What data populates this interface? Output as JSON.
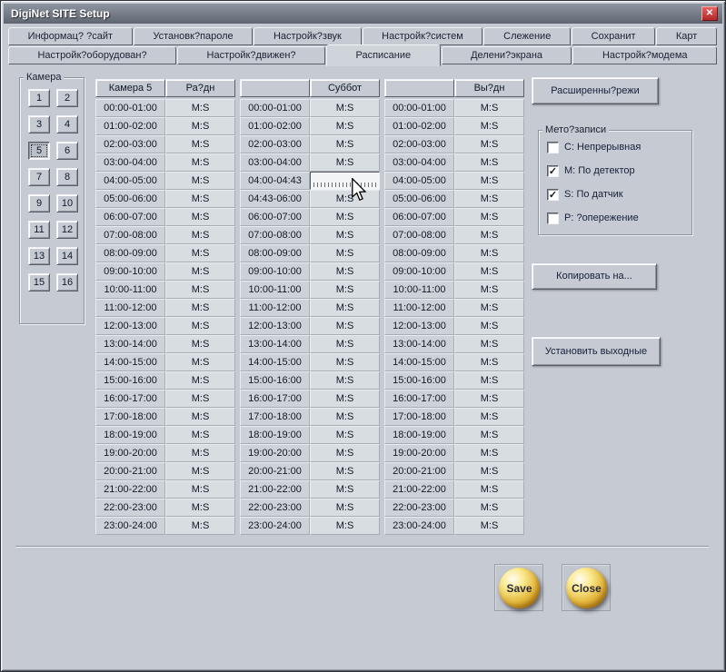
{
  "window": {
    "title": "DigiNet SITE Setup",
    "close_glyph": "✕"
  },
  "tabs": {
    "row1": [
      {
        "label": "Информац? ?сайт",
        "active": false
      },
      {
        "label": "Установк?пароле",
        "active": false
      },
      {
        "label": "Настройк?звук",
        "active": false
      },
      {
        "label": "Настройк?систем",
        "active": false
      },
      {
        "label": "Слежение",
        "active": false
      },
      {
        "label": "Сохранит",
        "active": false
      },
      {
        "label": "Карт",
        "active": false
      }
    ],
    "row2": [
      {
        "label": "Настройк?оборудован?",
        "active": false
      },
      {
        "label": "Настройк?движен?",
        "active": false
      },
      {
        "label": "Расписание",
        "active": true
      },
      {
        "label": "Делени?экрана",
        "active": false
      },
      {
        "label": "Настройк?модема",
        "active": false
      }
    ]
  },
  "camera": {
    "group_label": "Камера",
    "buttons": [
      "1",
      "2",
      "3",
      "4",
      "5",
      "6",
      "7",
      "8",
      "9",
      "10",
      "11",
      "12",
      "13",
      "14",
      "15",
      "16"
    ],
    "selected": "5"
  },
  "schedule": {
    "groups": [
      {
        "time_header": "Камера 5",
        "value_header": "Ра?дн",
        "times": [
          "00:00-01:00",
          "01:00-02:00",
          "02:00-03:00",
          "03:00-04:00",
          "04:00-05:00",
          "05:00-06:00",
          "06:00-07:00",
          "07:00-08:00",
          "08:00-09:00",
          "09:00-10:00",
          "10:00-11:00",
          "11:00-12:00",
          "12:00-13:00",
          "13:00-14:00",
          "14:00-15:00",
          "15:00-16:00",
          "16:00-17:00",
          "17:00-18:00",
          "18:00-19:00",
          "19:00-20:00",
          "20:00-21:00",
          "21:00-22:00",
          "22:00-23:00",
          "23:00-24:00"
        ],
        "values": [
          "M:S",
          "M:S",
          "M:S",
          "M:S",
          "M:S",
          "M:S",
          "M:S",
          "M:S",
          "M:S",
          "M:S",
          "M:S",
          "M:S",
          "M:S",
          "M:S",
          "M:S",
          "M:S",
          "M:S",
          "M:S",
          "M:S",
          "M:S",
          "M:S",
          "M:S",
          "M:S",
          "M:S"
        ]
      },
      {
        "time_header": "",
        "value_header": "Суббот",
        "times": [
          "00:00-01:00",
          "01:00-02:00",
          "02:00-03:00",
          "03:00-04:00",
          "04:00-04:43",
          "04:43-06:00",
          "06:00-07:00",
          "07:00-08:00",
          "08:00-09:00",
          "09:00-10:00",
          "10:00-11:00",
          "11:00-12:00",
          "12:00-13:00",
          "13:00-14:00",
          "14:00-15:00",
          "15:00-16:00",
          "16:00-17:00",
          "17:00-18:00",
          "18:00-19:00",
          "19:00-20:00",
          "20:00-21:00",
          "21:00-22:00",
          "22:00-23:00",
          "23:00-24:00"
        ],
        "values": [
          "M:S",
          "M:S",
          "M:S",
          "M:S",
          "",
          "M:S",
          "M:S",
          "M:S",
          "M:S",
          "M:S",
          "M:S",
          "M:S",
          "M:S",
          "M:S",
          "M:S",
          "M:S",
          "M:S",
          "M:S",
          "M:S",
          "M:S",
          "M:S",
          "M:S",
          "M:S",
          "M:S"
        ],
        "edited_row": 4
      },
      {
        "time_header": "",
        "value_header": "Вы?дн",
        "times": [
          "00:00-01:00",
          "01:00-02:00",
          "02:00-03:00",
          "03:00-04:00",
          "04:00-05:00",
          "05:00-06:00",
          "06:00-07:00",
          "07:00-08:00",
          "08:00-09:00",
          "09:00-10:00",
          "10:00-11:00",
          "11:00-12:00",
          "12:00-13:00",
          "13:00-14:00",
          "14:00-15:00",
          "15:00-16:00",
          "16:00-17:00",
          "17:00-18:00",
          "18:00-19:00",
          "19:00-20:00",
          "20:00-21:00",
          "21:00-22:00",
          "22:00-23:00",
          "23:00-24:00"
        ],
        "values": [
          "M:S",
          "M:S",
          "M:S",
          "M:S",
          "M:S",
          "M:S",
          "M:S",
          "M:S",
          "M:S",
          "M:S",
          "M:S",
          "M:S",
          "M:S",
          "M:S",
          "M:S",
          "M:S",
          "M:S",
          "M:S",
          "M:S",
          "M:S",
          "M:S",
          "M:S",
          "M:S",
          "M:S"
        ]
      }
    ]
  },
  "right_panel": {
    "advanced_label": "Расширенны?режи",
    "method_group_label": "Мето?записи",
    "checkboxes": [
      {
        "label": "C: Непрерывная",
        "checked": false
      },
      {
        "label": "M: По детектор",
        "checked": true
      },
      {
        "label": "S: По датчик",
        "checked": true
      },
      {
        "label": "P: ?опережение",
        "checked": false
      }
    ],
    "check_glyph": "✓",
    "copy_label": "Копировать на...",
    "holidays_label": "Установить выходные"
  },
  "footer": {
    "save_label": "Save",
    "close_label": "Close"
  },
  "colors": {
    "dialog_bg": "#c6cad2",
    "gold": "#e3b83e",
    "close_red": "#b02828"
  }
}
